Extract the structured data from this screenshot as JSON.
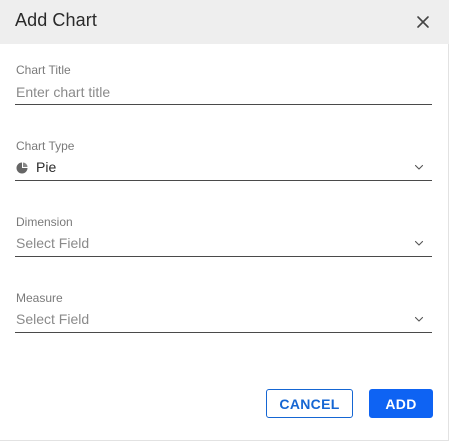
{
  "dialog": {
    "title": "Add Chart",
    "close_icon": "close-icon"
  },
  "fields": {
    "chart_title": {
      "label": "Chart Title",
      "placeholder": "Enter chart title",
      "value": ""
    },
    "chart_type": {
      "label": "Chart Type",
      "selected": "Pie",
      "icon": "pie-chart-icon"
    },
    "dimension": {
      "label": "Dimension",
      "placeholder": "Select Field"
    },
    "measure": {
      "label": "Measure",
      "placeholder": "Select Field"
    }
  },
  "actions": {
    "cancel_label": "CANCEL",
    "add_label": "ADD"
  },
  "colors": {
    "header_bg": "#eeeeee",
    "primary": "#0e63f3",
    "secondary_text": "#1566d3"
  }
}
